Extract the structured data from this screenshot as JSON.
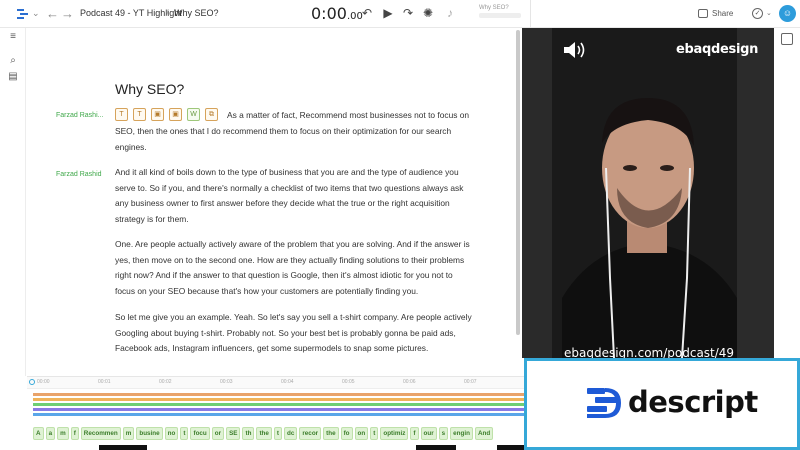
{
  "topbar": {
    "project_title": "Podcast 49 - YT Highlight",
    "breadcrumb_sep": "/",
    "composition_title": "Why SEO?",
    "timecode_main": "0:00",
    "timecode_sub": ".00",
    "scene_label": "Why SEO?",
    "share_label": "Share",
    "icons": [
      "descript-logo-icon",
      "chevron-down-icon",
      "back-arrow-icon",
      "forward-arrow-icon",
      "rewind-icon",
      "play-icon",
      "redo-icon",
      "loop-icon",
      "volume-icon",
      "share-icon",
      "checkmark-icon",
      "user-avatar"
    ]
  },
  "left_rail": {
    "icons": [
      "menu-icon",
      "search-icon",
      "document-icon"
    ]
  },
  "editor": {
    "title": "Why SEO?",
    "toolbar_icons": [
      "text-format-icon",
      "text-format-icon",
      "image-icon",
      "image-icon",
      "word-icon",
      "copy-icon"
    ],
    "toolbar_glyphs": [
      "T",
      "T",
      "▣",
      "▣",
      "W",
      "⧉"
    ],
    "paragraphs": [
      {
        "speaker": "Farzad Rashi...",
        "text_first": "As a matter of fact, Recommend most businesses not to focus on",
        "text_rest": "SEO, then the ones that I do recommend them to focus on their optimization for our search engines."
      },
      {
        "speaker": "Farzad Rashid",
        "text": "And it all kind of boils down to the type of business that you are and the type of audience you serve to. So if you, and there's normally a checklist of two items that two questions always ask any business owner to first answer before they decide what the true or the right acquisition strategy is for them."
      },
      {
        "speaker": "",
        "text": "One. Are people actually actively aware of the problem that you are solving. And if the answer is yes, then move on to the second one. How are they actually finding solutions to their problems right now? And if the answer to that question is Google, then it's almost idiotic for you not to focus on your SEO because that's how your customers are potentially finding you."
      },
      {
        "speaker": "",
        "text": "So let me give you an example. Yeah. So let's say you sell a t-shirt company. Are people actively Googling about buying t-shirt. Probably not. So your best bet is probably gonna be paid ads, Facebook ads, Instagram influencers, get some supermodels to snap some pictures."
      }
    ]
  },
  "preview": {
    "watermark": "ebaqdesign",
    "url": "ebaqdesign.com/podcast/49",
    "speaker_icon": "speaker-icon"
  },
  "descript_card": {
    "brand": "descript",
    "logo_icon": "descript-logo-icon"
  },
  "timeline": {
    "ticks": [
      "00:00",
      "00:01",
      "00:02",
      "00:03",
      "00:04",
      "00:05",
      "00:06",
      "00:07",
      "00:08"
    ],
    "track_colors": [
      "#e9a36a",
      "#f0b35a",
      "#6fcf73",
      "#8a7be3",
      "#5aa6e9"
    ],
    "words": [
      "A",
      "a",
      "m",
      "f",
      "Recommen",
      "m",
      "busine",
      "no",
      "t",
      "focu",
      "or",
      "SE",
      "th",
      "the",
      "t",
      "dc",
      "recor",
      "the",
      "fo",
      "on",
      "t",
      "optimiz",
      "f",
      "our",
      "s",
      "engin",
      "And"
    ]
  },
  "colors": {
    "accent": "#35a8d8",
    "speaker_green": "#3fa84a"
  }
}
